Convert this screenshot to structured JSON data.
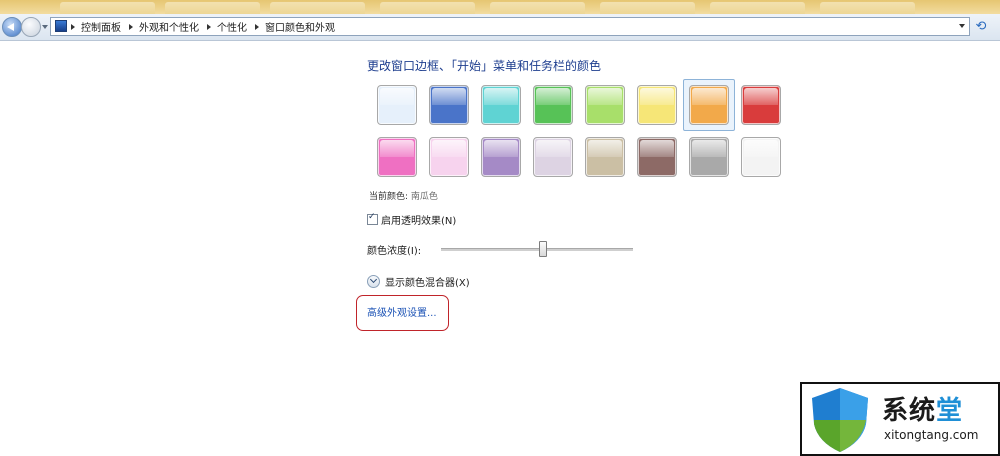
{
  "address_bar": {
    "breadcrumbs": [
      "控制面板",
      "外观和个性化",
      "个性化",
      "窗口颜色和外观"
    ]
  },
  "page": {
    "title": "更改窗口边框、「开始」菜单和任务栏的颜色",
    "current_color_label": "当前颜色:",
    "current_color_value": "南瓜色",
    "transparency_label": "启用透明效果(N)",
    "transparency_checked": true,
    "intensity_label": "颜色浓度(I):",
    "intensity_level": 0.53,
    "mixer_label": "显示颜色混合器(X)",
    "advanced_link": "高级外观设置..."
  },
  "swatches": [
    {
      "color": "#e6f0fb",
      "selected": false
    },
    {
      "color": "#4a74c9",
      "selected": false
    },
    {
      "color": "#5fd3d3",
      "selected": false
    },
    {
      "color": "#57c257",
      "selected": false
    },
    {
      "color": "#a8df6a",
      "selected": false
    },
    {
      "color": "#f6e677",
      "selected": false
    },
    {
      "color": "#f2a94a",
      "selected": true
    },
    {
      "color": "#d93c3c",
      "selected": false
    },
    {
      "color": "#ef70c2",
      "selected": false
    },
    {
      "color": "#f7d3ee",
      "selected": false
    },
    {
      "color": "#a58ac6",
      "selected": false
    },
    {
      "color": "#ddd3e3",
      "selected": false
    },
    {
      "color": "#cbbfa4",
      "selected": false
    },
    {
      "color": "#8d6a66",
      "selected": false
    },
    {
      "color": "#a9a9a9",
      "selected": false
    },
    {
      "color": "#f3f3f3",
      "selected": false
    }
  ],
  "watermark": {
    "name_part1": "系统",
    "name_part2": "堂",
    "domain": "xitongtang.com"
  }
}
